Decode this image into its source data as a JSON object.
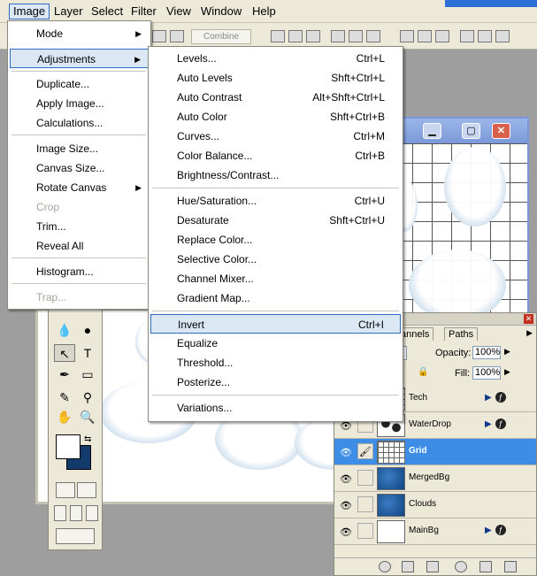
{
  "menubar": {
    "items": [
      "Image",
      "Layer",
      "Select",
      "Filter",
      "View",
      "Window",
      "Help"
    ],
    "active": "Image"
  },
  "options_bar": {
    "combine_label": "Combine"
  },
  "image_menu": [
    {
      "label": "Mode",
      "submenu": true
    },
    {
      "label": "Adjustments",
      "submenu": true,
      "highlighted": true
    },
    {
      "label": "Duplicate..."
    },
    {
      "label": "Apply Image..."
    },
    {
      "label": "Calculations..."
    },
    {
      "label": "Image Size..."
    },
    {
      "label": "Canvas Size..."
    },
    {
      "label": "Rotate Canvas",
      "submenu": true
    },
    {
      "label": "Crop",
      "disabled": true
    },
    {
      "label": "Trim..."
    },
    {
      "label": "Reveal All"
    },
    {
      "label": "Histogram..."
    },
    {
      "label": "Trap...",
      "disabled": true
    }
  ],
  "adjustments_menu": [
    {
      "label": "Levels...",
      "shortcut": "Ctrl+L"
    },
    {
      "label": "Auto Levels",
      "shortcut": "Shft+Ctrl+L"
    },
    {
      "label": "Auto Contrast",
      "shortcut": "Alt+Shft+Ctrl+L"
    },
    {
      "label": "Auto Color",
      "shortcut": "Shft+Ctrl+B"
    },
    {
      "label": "Curves...",
      "shortcut": "Ctrl+M"
    },
    {
      "label": "Color Balance...",
      "shortcut": "Ctrl+B"
    },
    {
      "label": "Brightness/Contrast...",
      "shortcut": ""
    },
    {
      "label": "Hue/Saturation...",
      "shortcut": "Ctrl+U"
    },
    {
      "label": "Desaturate",
      "shortcut": "Shft+Ctrl+U"
    },
    {
      "label": "Replace Color...",
      "shortcut": ""
    },
    {
      "label": "Selective Color...",
      "shortcut": ""
    },
    {
      "label": "Channel Mixer...",
      "shortcut": ""
    },
    {
      "label": "Gradient Map...",
      "shortcut": ""
    },
    {
      "label": "Invert",
      "shortcut": "Ctrl+I",
      "highlighted": true
    },
    {
      "label": "Equalize",
      "shortcut": ""
    },
    {
      "label": "Threshold...",
      "shortcut": ""
    },
    {
      "label": "Posterize...",
      "shortcut": ""
    },
    {
      "label": "Variations...",
      "shortcut": ""
    }
  ],
  "layers_panel": {
    "tabs": [
      "annels",
      "Paths"
    ],
    "opacity_label": "Opacity:",
    "opacity_value": "100%",
    "fill_label": "Fill:",
    "fill_value": "100%",
    "layers": [
      {
        "name": "Tech",
        "fx": true,
        "selected": false,
        "thumb": "grid"
      },
      {
        "name": "WaterDrop",
        "fx": true,
        "selected": false,
        "thumb": "drops"
      },
      {
        "name": "Grid",
        "fx": false,
        "selected": true,
        "thumb": "grid"
      },
      {
        "name": "MergedBg",
        "fx": false,
        "selected": false,
        "thumb": "blue"
      },
      {
        "name": "Clouds",
        "fx": false,
        "selected": false,
        "thumb": "blue"
      },
      {
        "name": "MainBg",
        "fx": true,
        "selected": false,
        "thumb": "white"
      }
    ]
  },
  "colors": {
    "menu_highlight": "#dce7f4",
    "layer_selected": "#3d8de6",
    "background_color": "#123a6b"
  }
}
